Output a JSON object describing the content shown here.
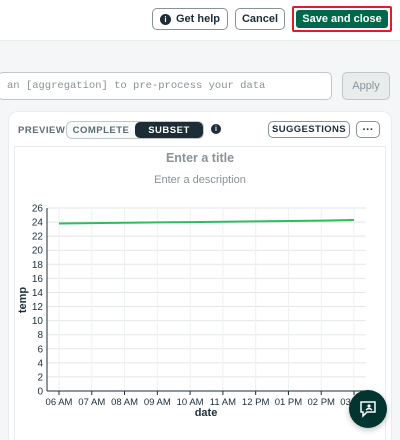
{
  "header": {
    "help_label": "Get help",
    "cancel_label": "Cancel",
    "save_label": "Save and close"
  },
  "pipeline": {
    "placeholder": "an [aggregation] to pre-process your data",
    "apply_label": "Apply"
  },
  "preview": {
    "label": "PREVIEW",
    "tabs": [
      "COMPLETE",
      "SUBSET"
    ],
    "active_tab": "SUBSET",
    "suggestions_label": "SUGGESTIONS",
    "more_label": "···"
  },
  "chart": {
    "title_placeholder": "Enter a title",
    "description_placeholder": "Enter a description"
  },
  "colors": {
    "accent": "#00684a",
    "line": "#2dbd60",
    "highlight": "#e21b2a"
  },
  "chart_data": {
    "type": "line",
    "title": "",
    "xlabel": "date",
    "ylabel": "temp",
    "x": [
      "06 AM",
      "07 AM",
      "08 AM",
      "09 AM",
      "10 AM",
      "11 AM",
      "12 PM",
      "01 PM",
      "02 PM",
      "03 PM"
    ],
    "series": [
      {
        "values": [
          23.8,
          23.85,
          23.9,
          23.95,
          24.0,
          24.05,
          24.1,
          24.15,
          24.2,
          24.3
        ]
      }
    ],
    "yticks": [
      0,
      2,
      4,
      6,
      8,
      10,
      12,
      14,
      16,
      18,
      20,
      22,
      24,
      26
    ],
    "ylim": [
      0,
      26
    ],
    "grid": true
  }
}
